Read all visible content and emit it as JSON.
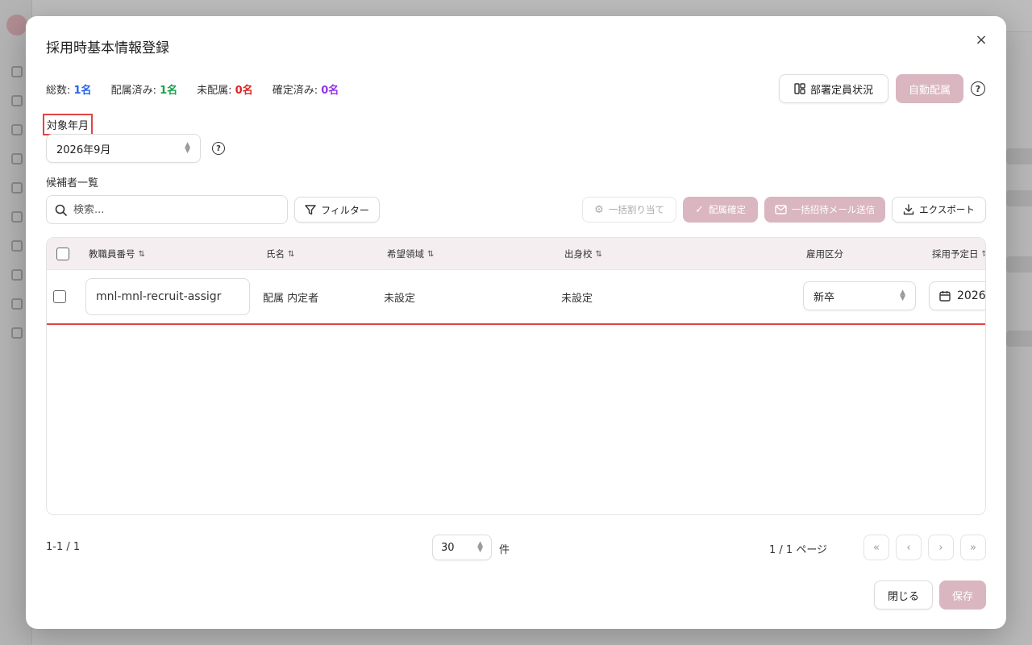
{
  "modal": {
    "title": "採用時基本情報登録",
    "close_icon": "×"
  },
  "stats": [
    {
      "label": "総数: ",
      "value": "1名",
      "color": "#2563eb"
    },
    {
      "label": "配属済み: ",
      "value": "1名",
      "color": "#16a34a"
    },
    {
      "label": "未配属: ",
      "value": "0名",
      "color": "#dc2626"
    },
    {
      "label": "確定済み: ",
      "value": "0名",
      "color": "#9333ea"
    }
  ],
  "top_actions": {
    "dept_status_label": "部署定員状況",
    "auto_assign_label": "自動配属"
  },
  "target_month": {
    "label": "対象年月",
    "value": "2026年9月"
  },
  "candidates": {
    "section_label": "候補者一覧",
    "search_placeholder": "検索...",
    "filter_label": "フィルター",
    "bulk_assign_label": "一括割り当て",
    "confirm_assign_label": "配属確定",
    "bulk_invite_label": "一括招待メール送信",
    "export_label": "エクスポート"
  },
  "table": {
    "columns": [
      "教職員番号",
      "氏名",
      "希望領域",
      "出身校",
      "雇用区分",
      "採用予定日"
    ],
    "rows": [
      {
        "employee_no": "mnl-mnl-recruit-assigr",
        "name": "配属 内定者",
        "preferred_area": "未設定",
        "school": "未設定",
        "employment_type": "新卒",
        "planned_date": "2026"
      }
    ]
  },
  "footer": {
    "range": "1-1 / 1",
    "page_size": "30",
    "page_size_unit": "件",
    "page_info": "1 / 1 ページ",
    "close_label": "閉じる",
    "save_label": "保存"
  },
  "colors": {
    "accent_pink": "#d9b6c0",
    "highlight_red": "#e04545"
  }
}
